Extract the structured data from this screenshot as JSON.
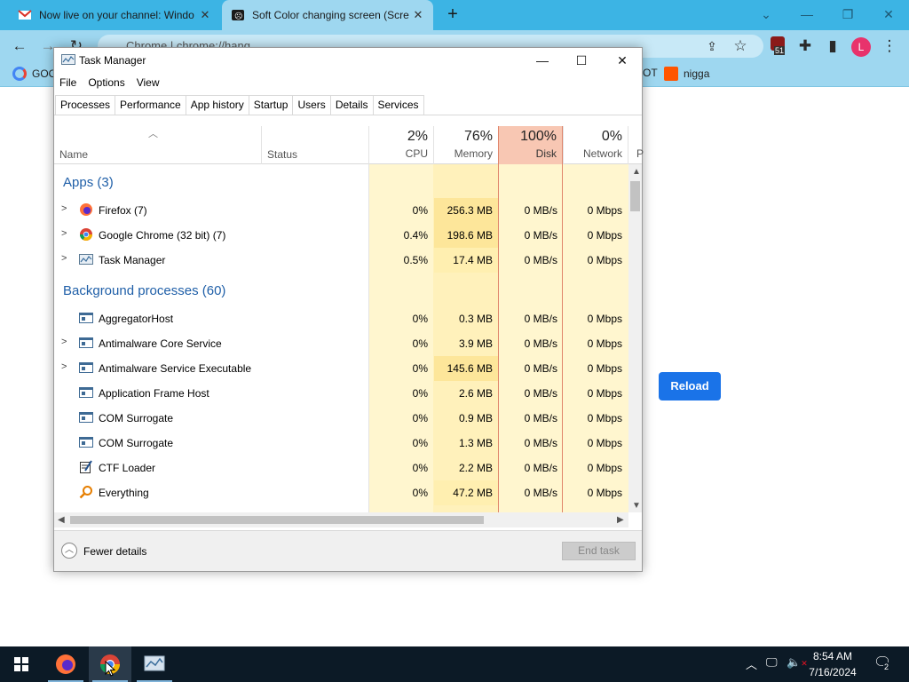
{
  "browser": {
    "tabs": [
      {
        "title": "Now live on your channel: Windo",
        "active": false
      },
      {
        "title": "Soft Color changing screen (Scre",
        "active": true
      }
    ],
    "address": "chrome://hang",
    "address_prefix": "Chrome",
    "bookmarks": [
      {
        "label": "GOO"
      },
      {
        "label": "OT"
      },
      {
        "label": "nigga"
      }
    ],
    "extension_badge": "51",
    "profile_initial": "L",
    "page_button": "Reload",
    "colors": {
      "tabstrip": "#3cb4e4",
      "toolbar": "#9ed7f0",
      "accent": "#1a73e8"
    }
  },
  "taskmanager": {
    "title": "Task Manager",
    "menu": [
      "File",
      "Options",
      "View"
    ],
    "tabs": [
      "Processes",
      "Performance",
      "App history",
      "Startup",
      "Users",
      "Details",
      "Services"
    ],
    "active_tab": "Processes",
    "header": {
      "name": "Name",
      "status": "Status",
      "cpu": {
        "pct": "2%",
        "label": "CPU"
      },
      "memory": {
        "pct": "76%",
        "label": "Memory"
      },
      "disk": {
        "pct": "100%",
        "label": "Disk"
      },
      "network": {
        "pct": "0%",
        "label": "Network"
      },
      "power_partial": "P"
    },
    "groups": {
      "apps": "Apps (3)",
      "background": "Background processes (60)"
    },
    "apps": [
      {
        "name": "Firefox (7)",
        "icon": "firefox-icon",
        "expandable": true,
        "cpu": "0%",
        "memory": "256.3 MB",
        "disk": "0 MB/s",
        "network": "0 Mbps"
      },
      {
        "name": "Google Chrome (32 bit) (7)",
        "icon": "chrome-icon",
        "expandable": true,
        "cpu": "0.4%",
        "memory": "198.6 MB",
        "disk": "0 MB/s",
        "network": "0 Mbps"
      },
      {
        "name": "Task Manager",
        "icon": "taskmanager-icon",
        "expandable": true,
        "cpu": "0.5%",
        "memory": "17.4 MB",
        "disk": "0 MB/s",
        "network": "0 Mbps"
      }
    ],
    "background": [
      {
        "name": "AggregatorHost",
        "icon": "process-icon",
        "expandable": false,
        "cpu": "0%",
        "memory": "0.3 MB",
        "disk": "0 MB/s",
        "network": "0 Mbps"
      },
      {
        "name": "Antimalware Core Service",
        "icon": "process-icon",
        "expandable": true,
        "cpu": "0%",
        "memory": "3.9 MB",
        "disk": "0 MB/s",
        "network": "0 Mbps"
      },
      {
        "name": "Antimalware Service Executable",
        "icon": "process-icon",
        "expandable": true,
        "cpu": "0%",
        "memory": "145.6 MB",
        "disk": "0 MB/s",
        "network": "0 Mbps"
      },
      {
        "name": "Application Frame Host",
        "icon": "process-icon",
        "expandable": false,
        "cpu": "0%",
        "memory": "2.6 MB",
        "disk": "0 MB/s",
        "network": "0 Mbps"
      },
      {
        "name": "COM Surrogate",
        "icon": "process-icon",
        "expandable": false,
        "cpu": "0%",
        "memory": "0.9 MB",
        "disk": "0 MB/s",
        "network": "0 Mbps"
      },
      {
        "name": "COM Surrogate",
        "icon": "process-icon",
        "expandable": false,
        "cpu": "0%",
        "memory": "1.3 MB",
        "disk": "0 MB/s",
        "network": "0 Mbps"
      },
      {
        "name": "CTF Loader",
        "icon": "ctf-icon",
        "expandable": false,
        "cpu": "0%",
        "memory": "2.2 MB",
        "disk": "0 MB/s",
        "network": "0 Mbps"
      },
      {
        "name": "Everything",
        "icon": "everything-icon",
        "expandable": false,
        "cpu": "0%",
        "memory": "47.2 MB",
        "disk": "0 MB/s",
        "network": "0 Mbps"
      }
    ],
    "footer": {
      "fewer": "Fewer details",
      "end_task": "End task"
    },
    "colors": {
      "disk_header": "#f8c7b3",
      "heat_low": "#fff6cf",
      "heat_mid": "#ffefb0",
      "heat_high": "#fde69a",
      "group_title": "#1f5fa8"
    }
  },
  "taskbar": {
    "time": "8:54 AM",
    "date": "7/16/2024",
    "notification_count": "2",
    "colors": {
      "background": "#0c1a26"
    }
  }
}
